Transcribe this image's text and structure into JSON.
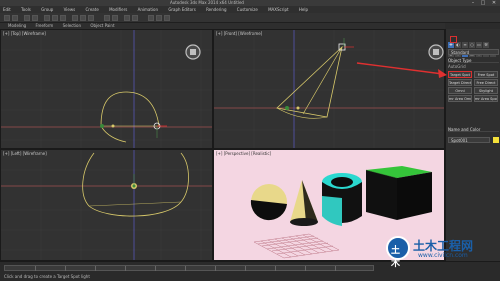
{
  "window": {
    "title": "Autodesk 3ds Max  2014 x64    Untitled",
    "controls": [
      "–",
      "□",
      "✕"
    ]
  },
  "menu": [
    "Edit",
    "Tools",
    "Group",
    "Views",
    "Create",
    "Modifiers",
    "Animation",
    "Graph Editors",
    "Rendering",
    "Customize",
    "MAXScript",
    "Help"
  ],
  "ribbon": [
    "Modeling",
    "Freeform",
    "Selection",
    "Object Paint"
  ],
  "viewports": {
    "top_left": "[+] [Top] [Wireframe]",
    "top_right": "[+] [Front] [Wireframe]",
    "bottom_left": "[+] [Left] [Wireframe]",
    "bottom_right": "[+] [Perspective] [Realistic]"
  },
  "command_panel": {
    "dropdown": "Standard",
    "object_type_header": "Object Type",
    "autogrid": "AutoGrid",
    "buttons": [
      {
        "label": "Target Spot",
        "highlight": true
      },
      {
        "label": "Free Spot",
        "highlight": false
      },
      {
        "label": "Target Direct",
        "highlight": false
      },
      {
        "label": "Free Direct",
        "highlight": false
      },
      {
        "label": "Omni",
        "highlight": false
      },
      {
        "label": "Skylight",
        "highlight": false
      },
      {
        "label": "mr Area Omni",
        "highlight": false
      },
      {
        "label": "mr Area Spot",
        "highlight": false
      }
    ],
    "name_color_header": "Name and Color",
    "name_value": "Spot001",
    "swatch_color": "#f5e13a"
  },
  "status": {
    "text": "Click and drag to create a Target Spot light"
  },
  "watermark": {
    "logo_text": "土木",
    "name": "土木工程网",
    "url": "www.civilcn.com"
  },
  "colors": {
    "accent": "#3f6fb5",
    "highlight": "#d93030",
    "light_gizmo": "#d8c96a",
    "persp_bg": "#f4d6e2"
  }
}
